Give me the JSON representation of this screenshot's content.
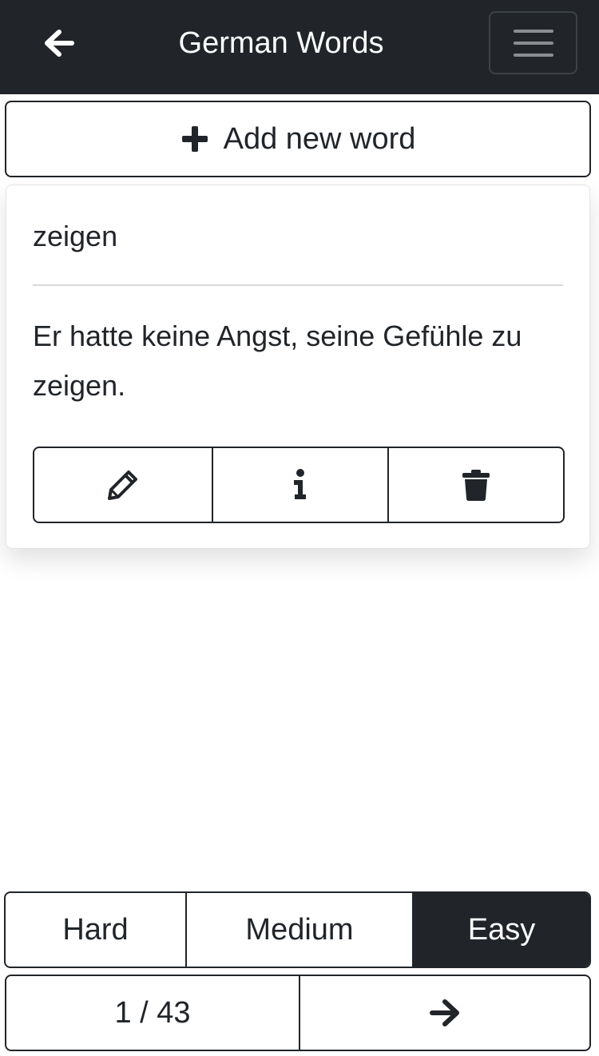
{
  "header": {
    "title": "German Words",
    "back_icon": "arrow-left-icon",
    "menu_icon": "hamburger-menu-icon",
    "background": "#212529"
  },
  "add_button": {
    "icon": "plus-icon",
    "label": "Add new word"
  },
  "card": {
    "word": "zeigen",
    "example": "Er hatte keine Angst, seine Gefühle zu zeigen.",
    "actions": [
      {
        "name": "edit",
        "icon": "pencil-icon"
      },
      {
        "name": "info",
        "icon": "info-icon"
      },
      {
        "name": "delete",
        "icon": "trash-icon"
      }
    ]
  },
  "difficulty": {
    "options": [
      "Hard",
      "Medium",
      "Easy"
    ],
    "selected": "Easy",
    "active_color": "#212529"
  },
  "pager": {
    "position": "1 / 43",
    "current": 1,
    "total": 43,
    "next_icon": "arrow-right-icon"
  }
}
